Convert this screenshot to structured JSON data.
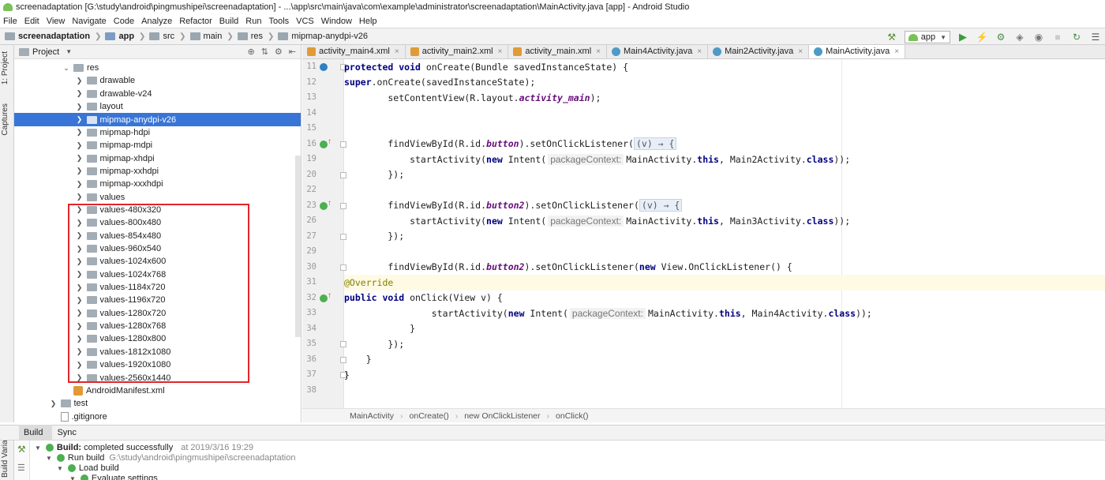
{
  "window": {
    "title": "screenadaptation [G:\\study\\android\\pingmushipei\\screenadaptation] - ...\\app\\src\\main\\java\\com\\example\\administrator\\screenadaptation\\MainActivity.java [app] - Android Studio"
  },
  "menu": [
    "File",
    "Edit",
    "View",
    "Navigate",
    "Code",
    "Analyze",
    "Refactor",
    "Build",
    "Run",
    "Tools",
    "VCS",
    "Window",
    "Help"
  ],
  "breadcrumb": [
    "screenadaptation",
    "app",
    "src",
    "main",
    "res",
    "mipmap-anydpi-v26"
  ],
  "toolbar": {
    "run_config": "app"
  },
  "side_tabs": {
    "project": "1: Project",
    "captures": "Captures",
    "build_variants": "Build Variants"
  },
  "project_panel": {
    "title": "Project",
    "items": [
      {
        "label": "res",
        "indent": 4,
        "expanded": true
      },
      {
        "label": "drawable",
        "indent": 5
      },
      {
        "label": "drawable-v24",
        "indent": 5
      },
      {
        "label": "layout",
        "indent": 5
      },
      {
        "label": "mipmap-anydpi-v26",
        "indent": 5,
        "selected": true
      },
      {
        "label": "mipmap-hdpi",
        "indent": 5
      },
      {
        "label": "mipmap-mdpi",
        "indent": 5
      },
      {
        "label": "mipmap-xhdpi",
        "indent": 5
      },
      {
        "label": "mipmap-xxhdpi",
        "indent": 5
      },
      {
        "label": "mipmap-xxxhdpi",
        "indent": 5
      },
      {
        "label": "values",
        "indent": 5
      },
      {
        "label": "values-480x320",
        "indent": 5
      },
      {
        "label": "values-800x480",
        "indent": 5
      },
      {
        "label": "values-854x480",
        "indent": 5
      },
      {
        "label": "values-960x540",
        "indent": 5
      },
      {
        "label": "values-1024x600",
        "indent": 5
      },
      {
        "label": "values-1024x768",
        "indent": 5
      },
      {
        "label": "values-1184x720",
        "indent": 5
      },
      {
        "label": "values-1196x720",
        "indent": 5
      },
      {
        "label": "values-1280x720",
        "indent": 5
      },
      {
        "label": "values-1280x768",
        "indent": 5
      },
      {
        "label": "values-1280x800",
        "indent": 5
      },
      {
        "label": "values-1812x1080",
        "indent": 5
      },
      {
        "label": "values-1920x1080",
        "indent": 5
      },
      {
        "label": "values-2560x1440",
        "indent": 5
      },
      {
        "label": "AndroidManifest.xml",
        "indent": 4,
        "file": "xml"
      },
      {
        "label": "test",
        "indent": 3
      },
      {
        "label": ".gitignore",
        "indent": 3,
        "file": "plain"
      }
    ]
  },
  "editor_tabs": [
    {
      "label": "activity_main4.xml",
      "kind": "xml"
    },
    {
      "label": "activity_main2.xml",
      "kind": "xml"
    },
    {
      "label": "activity_main.xml",
      "kind": "xml"
    },
    {
      "label": "Main4Activity.java",
      "kind": "java"
    },
    {
      "label": "Main2Activity.java",
      "kind": "java"
    },
    {
      "label": "MainActivity.java",
      "kind": "java",
      "active": true
    }
  ],
  "code_lines": [
    {
      "num": "11",
      "mark": "o",
      "html": "    <span class='kw'>protected void</span> onCreate(Bundle savedInstanceState) {"
    },
    {
      "num": "12",
      "html": "        <span class='kw'>super</span>.onCreate(savedInstanceState);"
    },
    {
      "num": "13",
      "html": "        setContentView(R.layout.<span class='fld'>activity_main</span>);"
    },
    {
      "num": "14",
      "html": ""
    },
    {
      "num": "15",
      "html": ""
    },
    {
      "num": "16",
      "mark": "g",
      "html": "        findViewById(R.id.<span class='fld'>button</span>).setOnClickListener(<span class='lambda'>(v) → {</span>"
    },
    {
      "num": "19",
      "html": "            startActivity(<span class='kw'>new</span> Intent(<span class='hint'>packageContext:</span>MainActivity.<span class='kw'>this</span>, Main2Activity.<span class='kw'>class</span>));"
    },
    {
      "num": "20",
      "html": "        });"
    },
    {
      "num": "22",
      "html": ""
    },
    {
      "num": "23",
      "mark": "g",
      "html": "        findViewById(R.id.<span class='fld'>button2</span>).setOnClickListener(<span class='lambda'>(v) → {</span>"
    },
    {
      "num": "26",
      "html": "            startActivity(<span class='kw'>new</span> Intent(<span class='hint'>packageContext:</span>MainActivity.<span class='kw'>this</span>, Main3Activity.<span class='kw'>class</span>));"
    },
    {
      "num": "27",
      "html": "        });"
    },
    {
      "num": "29",
      "html": ""
    },
    {
      "num": "30",
      "html": "        findViewById(R.id.<span class='fld'>button2</span>).setOnClickListener(<span class='kw'>new</span> View.OnClickListener() {"
    },
    {
      "num": "31",
      "current": true,
      "html": "            <span class='ann'>@Override</span>"
    },
    {
      "num": "32",
      "mark": "g",
      "html": "            <span class='kw'>public void</span> onClick(View v) {"
    },
    {
      "num": "33",
      "html": "                startActivity(<span class='kw'>new</span> Intent(<span class='hint'>packageContext:</span>MainActivity.<span class='kw'>this</span>, Main4Activity.<span class='kw'>class</span>));"
    },
    {
      "num": "34",
      "html": "            }"
    },
    {
      "num": "35",
      "html": "        });"
    },
    {
      "num": "36",
      "html": "    }"
    },
    {
      "num": "37",
      "html": "}"
    },
    {
      "num": "38",
      "html": ""
    }
  ],
  "editor_breadcrumb": [
    "MainActivity",
    "onCreate()",
    "new OnClickListener",
    "onClick()"
  ],
  "bottom_tabs": [
    "Build",
    "Sync"
  ],
  "build": {
    "status_label": "Build:",
    "status_text": "completed successfully",
    "timestamp": "at 2019/3/16 19:29",
    "run_build": "Run build",
    "run_path": "G:\\study\\android\\pingmushipei\\screenadaptation",
    "load_build": "Load build",
    "evaluate": "Evaluate settings"
  }
}
